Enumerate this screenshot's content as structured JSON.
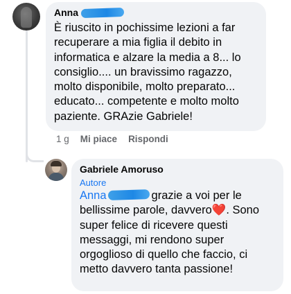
{
  "comment": {
    "author": "Anna",
    "text": "È riuscito in pochissime lezioni a far recuperare a mia figlia il debito in informatica e alzare la media a 8... lo consiglio.... un bravissimo ragazzo, molto disponibile, molto preparato... educato... competente e molto molto paziente. GRAzie Gabriele!",
    "time": "1 g",
    "like_label": "Mi piace",
    "reply_label": "Rispondi"
  },
  "reply": {
    "author": "Gabriele Amoruso",
    "badge": "Autore",
    "mention": "Anna",
    "text_part1": "grazie a voi per le bellissime parole, davvero",
    "heart": "❤️",
    "text_part2": ". Sono super felice di ricevere questi messaggi, mi rendono super orgoglioso di quello che faccio, ci metto davvero tanta passione!"
  },
  "colors": {
    "bubble": "#f0f2f5",
    "link": "#1877f2",
    "meta": "#65676b",
    "redaction": "#1e88e5"
  }
}
